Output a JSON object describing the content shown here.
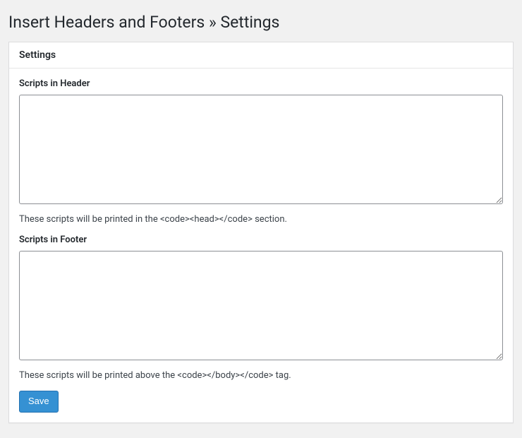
{
  "page_title": "Insert Headers and Footers » Settings",
  "panel": {
    "header_title": "Settings",
    "fields": {
      "header": {
        "label": "Scripts in Header",
        "value": "",
        "help": "These scripts will be printed in the <code><head></code> section."
      },
      "footer": {
        "label": "Scripts in Footer",
        "value": "",
        "help": "These scripts will be printed above the <code></body></code> tag."
      }
    },
    "save_label": "Save"
  }
}
